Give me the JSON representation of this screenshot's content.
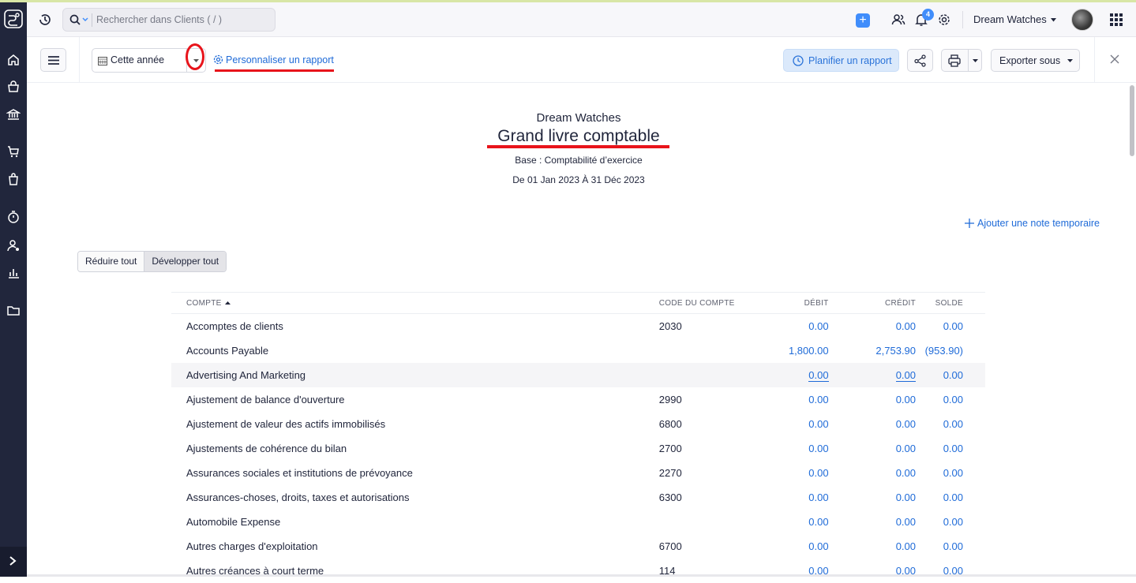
{
  "colors": {
    "sidebar": "#21263c",
    "accent": "#408dfb",
    "link": "#1f6bd8",
    "annotation": "#e8141b"
  },
  "sidebar": {
    "icons": [
      "logo-icon",
      "home-icon",
      "shopping-bag-icon",
      "bank-icon",
      "cart-icon",
      "purchases-icon",
      "timer-icon",
      "user-settings-icon",
      "reports-icon",
      "folder-icon"
    ],
    "expand_icon": "chevron-right-icon"
  },
  "topbar": {
    "search_placeholder": "Rechercher dans Clients ( / )",
    "notification_count": "4",
    "org_name": "Dream Watches"
  },
  "toolbar": {
    "period_label": "Cette année",
    "customize_label": "Personnaliser un rapport",
    "schedule_label": "Planifier un rapport",
    "export_label": "Exporter sous"
  },
  "report": {
    "company": "Dream Watches",
    "title": "Grand livre comptable",
    "basis": "Base : Comptabilité d’exercice",
    "range": "De 01 Jan 2023 À 31 Déc 2023",
    "add_note": "Ajouter une note temporaire",
    "collapse_label": "Réduire tout",
    "expand_label": "Développer tout"
  },
  "table": {
    "headers": {
      "account": "COMPTE",
      "code": "CODE DU COMPTE",
      "debit": "DÉBIT",
      "credit": "CRÉDIT",
      "balance": "SOLDE"
    },
    "rows": [
      {
        "name": "Accomptes de clients",
        "code": "2030",
        "debit": "0.00",
        "credit": "0.00",
        "balance": "0.00"
      },
      {
        "name": "Accounts Payable",
        "code": "",
        "debit": "1,800.00",
        "credit": "2,753.90",
        "balance": "(953.90)"
      },
      {
        "name": "Advertising And Marketing",
        "code": "",
        "debit": "0.00",
        "credit": "0.00",
        "balance": "0.00"
      },
      {
        "name": "Ajustement de balance d'ouverture",
        "code": "2990",
        "debit": "0.00",
        "credit": "0.00",
        "balance": "0.00"
      },
      {
        "name": "Ajustement de valeur des actifs immobilisés",
        "code": "6800",
        "debit": "0.00",
        "credit": "0.00",
        "balance": "0.00"
      },
      {
        "name": "Ajustements de cohérence du bilan",
        "code": "2700",
        "debit": "0.00",
        "credit": "0.00",
        "balance": "0.00"
      },
      {
        "name": "Assurances sociales et institutions de prévoyance",
        "code": "2270",
        "debit": "0.00",
        "credit": "0.00",
        "balance": "0.00"
      },
      {
        "name": "Assurances-choses, droits, taxes et autorisations",
        "code": "6300",
        "debit": "0.00",
        "credit": "0.00",
        "balance": "0.00"
      },
      {
        "name": "Automobile Expense",
        "code": "",
        "debit": "0.00",
        "credit": "0.00",
        "balance": "0.00"
      },
      {
        "name": "Autres charges d'exploitation",
        "code": "6700",
        "debit": "0.00",
        "credit": "0.00",
        "balance": "0.00"
      },
      {
        "name": "Autres créances à court terme",
        "code": "114",
        "debit": "0.00",
        "credit": "0.00",
        "balance": "0.00"
      }
    ]
  }
}
